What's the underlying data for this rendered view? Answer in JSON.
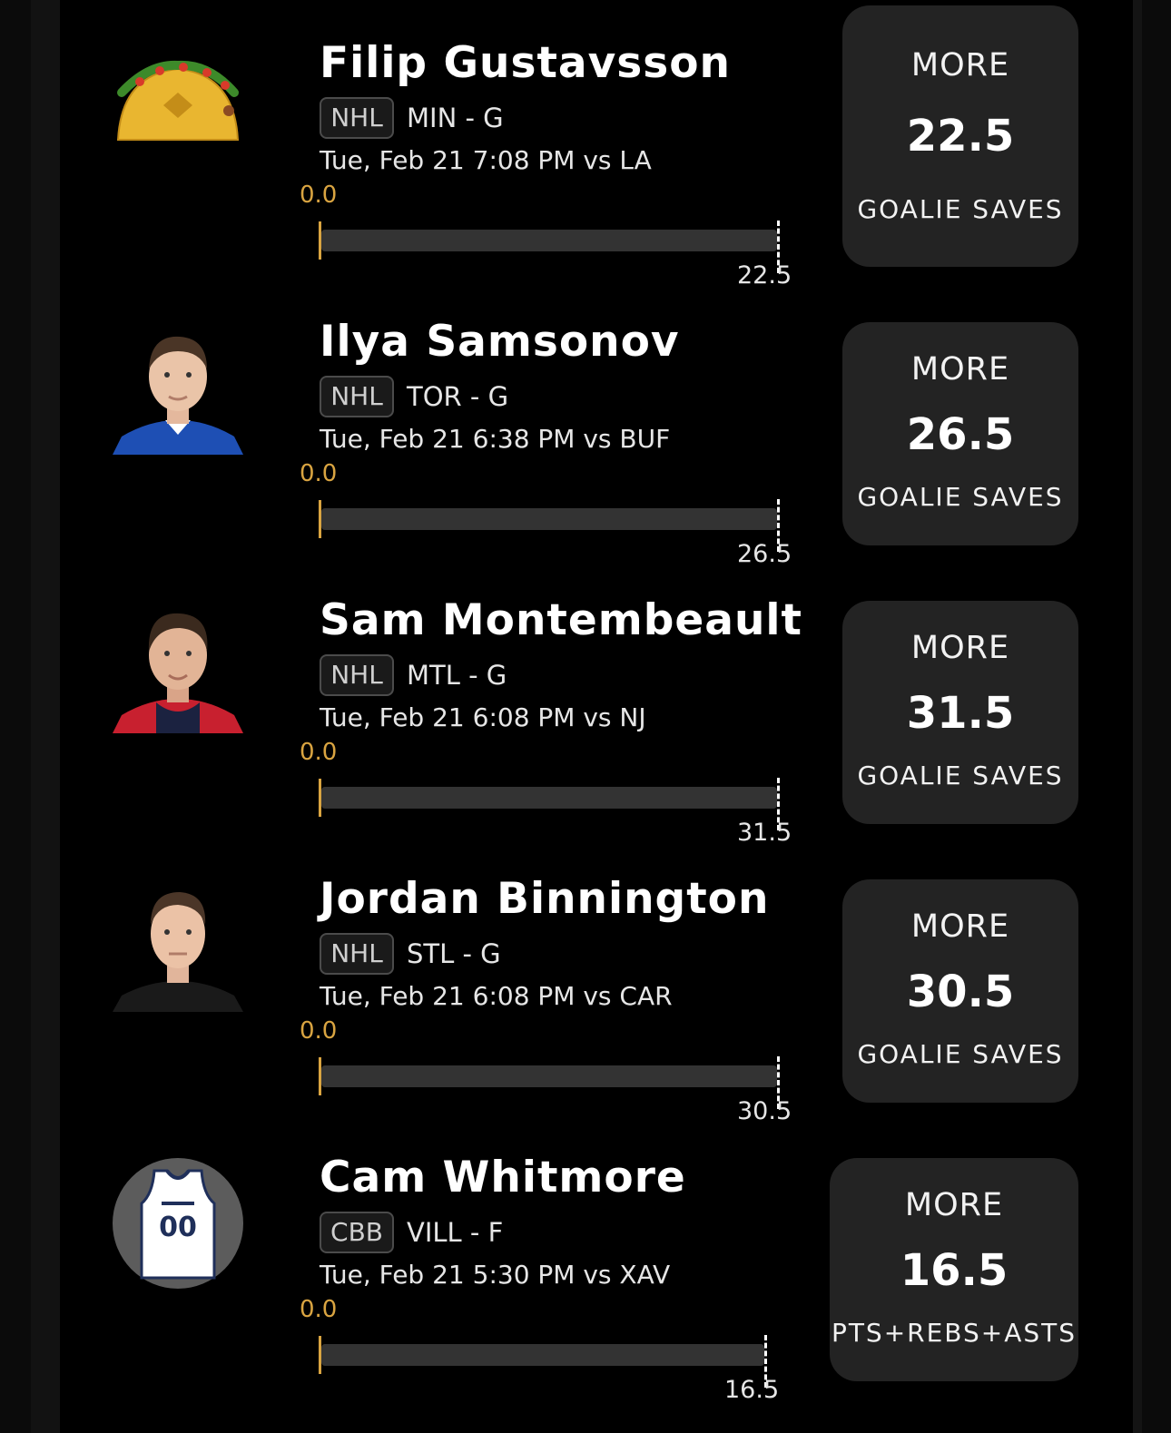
{
  "players": [
    {
      "name": "Filip Gustavsson",
      "league": "NHL",
      "team_position": "MIN - G",
      "game_time": "Tue, Feb 21 7:08 PM  vs LA",
      "current": "0.0",
      "target": "22.5",
      "progress_fraction": 0,
      "pick": {
        "direction": "MORE",
        "line": "22.5",
        "stat": "GOALIE SAVES"
      },
      "avatar": "taco-icon"
    },
    {
      "name": "Ilya Samsonov",
      "league": "NHL",
      "team_position": "TOR - G",
      "game_time": "Tue, Feb 21 6:38 PM  vs BUF",
      "current": "0.0",
      "target": "26.5",
      "progress_fraction": 0,
      "pick": {
        "direction": "MORE",
        "line": "26.5",
        "stat": "GOALIE SAVES"
      },
      "avatar": "player-headshot",
      "jersey_color": "#1e4fb4"
    },
    {
      "name": "Sam Montembeault",
      "league": "NHL",
      "team_position": "MTL - G",
      "game_time": "Tue, Feb 21 6:08 PM  vs NJ",
      "current": "0.0",
      "target": "31.5",
      "progress_fraction": 0,
      "pick": {
        "direction": "MORE",
        "line": "31.5",
        "stat": "GOALIE SAVES"
      },
      "avatar": "player-headshot",
      "jersey_color": "#c8202f"
    },
    {
      "name": "Jordan Binnington",
      "league": "NHL",
      "team_position": "STL - G",
      "game_time": "Tue, Feb 21 6:08 PM  vs CAR",
      "current": "0.0",
      "target": "30.5",
      "progress_fraction": 0,
      "pick": {
        "direction": "MORE",
        "line": "30.5",
        "stat": "GOALIE SAVES"
      },
      "avatar": "player-headshot",
      "jersey_color": "#1a1a1a"
    },
    {
      "name": "Cam Whitmore",
      "league": "CBB",
      "team_position": "VILL - F",
      "game_time": "Tue, Feb 21 5:30 PM  vs XAV",
      "current": "0.0",
      "target": "16.5",
      "progress_fraction": 0,
      "pick": {
        "direction": "MORE",
        "line": "16.5",
        "stat": "PTS+REBS+ASTS"
      },
      "avatar": "jersey-icon",
      "jersey_number": "00"
    }
  ],
  "colors": {
    "accent": "#d9a441",
    "card": "#232323",
    "track": "#333333",
    "background": "#000000"
  }
}
